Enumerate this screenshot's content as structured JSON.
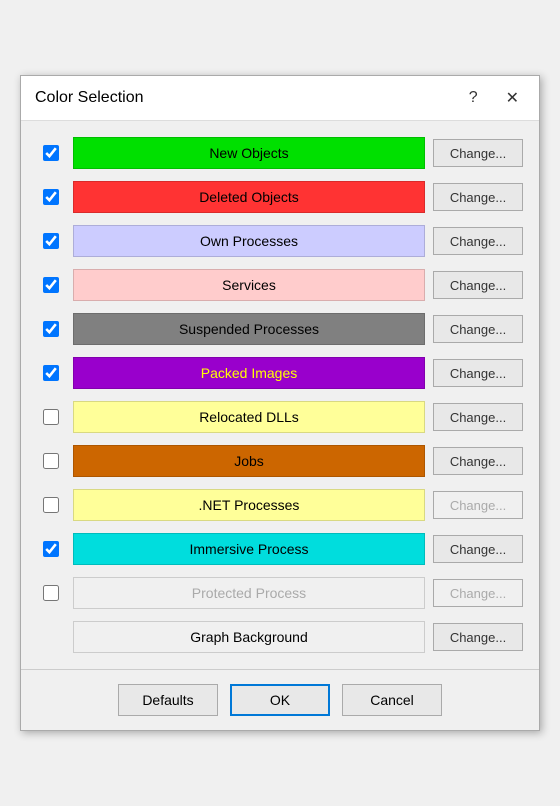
{
  "dialog": {
    "title": "Color Selection",
    "help_symbol": "?",
    "close_symbol": "✕"
  },
  "rows": [
    {
      "id": "new-objects",
      "label": "New Objects",
      "color": "#00e000",
      "text_color": "#000000",
      "checked": true,
      "change_enabled": true
    },
    {
      "id": "deleted-objects",
      "label": "Deleted Objects",
      "color": "#ff3333",
      "text_color": "#000000",
      "checked": true,
      "change_enabled": true
    },
    {
      "id": "own-processes",
      "label": "Own Processes",
      "color": "#ccccff",
      "text_color": "#000000",
      "checked": true,
      "change_enabled": true
    },
    {
      "id": "services",
      "label": "Services",
      "color": "#ffcccc",
      "text_color": "#000000",
      "checked": true,
      "change_enabled": true
    },
    {
      "id": "suspended-processes",
      "label": "Suspended Processes",
      "color": "#808080",
      "text_color": "#000000",
      "checked": true,
      "change_enabled": true
    },
    {
      "id": "packed-images",
      "label": "Packed Images",
      "color": "#9900cc",
      "text_color": "#ffff00",
      "checked": true,
      "change_enabled": true
    },
    {
      "id": "relocated-dlls",
      "label": "Relocated DLLs",
      "color": "#ffff99",
      "text_color": "#000000",
      "checked": false,
      "change_enabled": true
    },
    {
      "id": "jobs",
      "label": "Jobs",
      "color": "#cc6600",
      "text_color": "#000000",
      "checked": false,
      "change_enabled": true
    },
    {
      "id": "net-processes",
      "label": ".NET Processes",
      "color": "#ffff99",
      "text_color": "#000000",
      "checked": false,
      "change_enabled": false
    },
    {
      "id": "immersive-process",
      "label": "Immersive Process",
      "color": "#00dddd",
      "text_color": "#000000",
      "checked": true,
      "change_enabled": true
    },
    {
      "id": "protected-process",
      "label": "Protected Process",
      "color": "#f0f0f0",
      "text_color": "#aaaaaa",
      "checked": false,
      "change_enabled": false
    },
    {
      "id": "graph-background",
      "label": "Graph Background",
      "color": "#f0f0f0",
      "text_color": "#000000",
      "checked": null,
      "change_enabled": true
    }
  ],
  "buttons": {
    "defaults": "Defaults",
    "ok": "OK",
    "cancel": "Cancel",
    "change": "Change..."
  }
}
